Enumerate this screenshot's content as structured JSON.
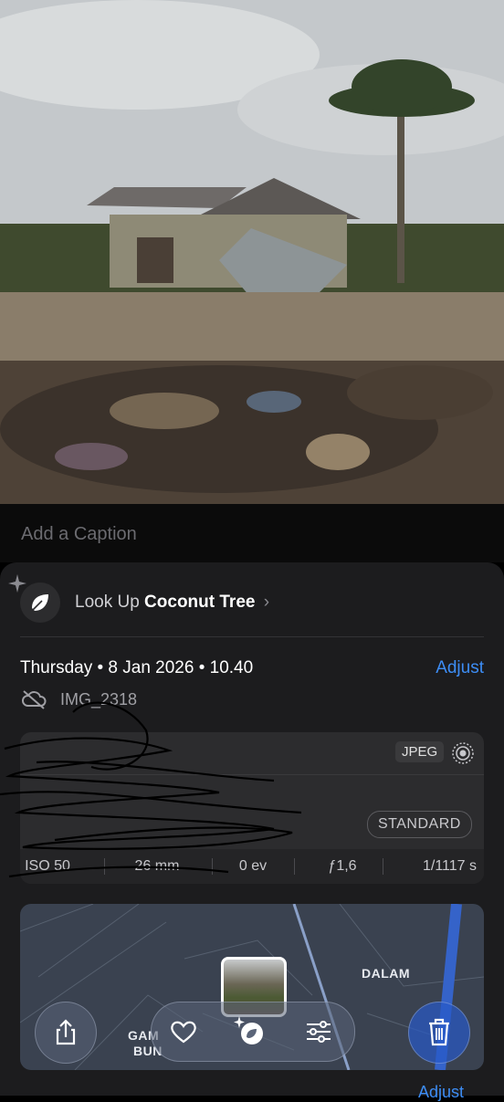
{
  "caption": {
    "placeholder": "Add a Caption"
  },
  "lookup": {
    "prefix": "Look Up ",
    "subject": "Coconut Tree",
    "chevron": "›",
    "icon": "leaf-icon"
  },
  "meta": {
    "date": "Thursday • 8 Jan 2026 • 10.40",
    "adjust_label": "Adjust",
    "filename": "IMG_2318",
    "cloud_icon": "cloud-slash-icon"
  },
  "info": {
    "format_badge": "JPEG",
    "style_badge": "STANDARD",
    "exif": [
      "ISO 50",
      "26 mm",
      "0 ev",
      "ƒ1,6",
      "1/1117 s"
    ]
  },
  "map": {
    "labels": [
      "DALAM",
      "GAM",
      "BUN"
    ]
  },
  "toolbar": {
    "share_icon": "share-icon",
    "favorite_icon": "heart-icon",
    "visual_lookup_icon": "visual-lookup-icon",
    "edit_icon": "sliders-icon",
    "delete_icon": "trash-icon"
  },
  "footer": {
    "adjust_label": "Adjust"
  },
  "colors": {
    "accent": "#3d8df5",
    "sheet": "#1c1c1e",
    "card": "#2c2c2e"
  }
}
